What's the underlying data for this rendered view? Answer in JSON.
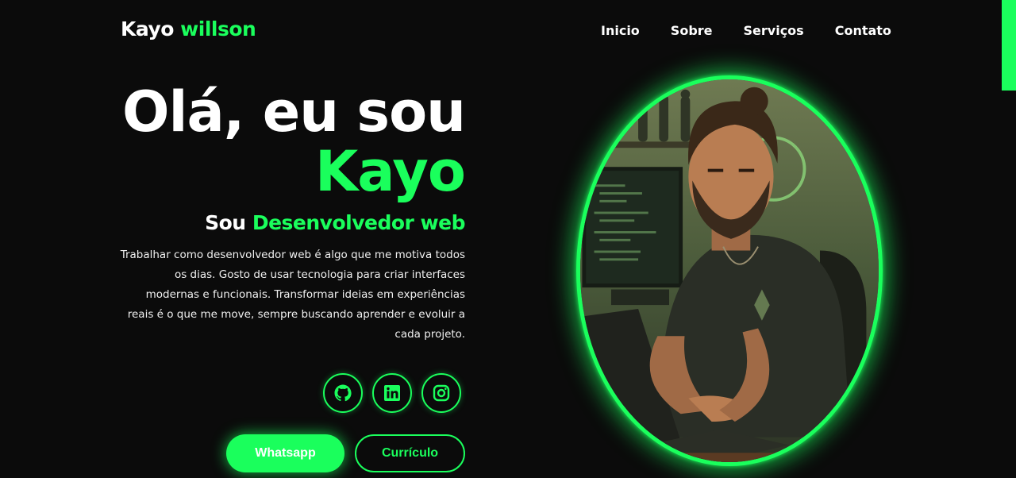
{
  "header": {
    "logo_first": "Kayo",
    "logo_second": "willson",
    "nav": [
      "Inicio",
      "Sobre",
      "Serviços",
      "Contato"
    ]
  },
  "hero": {
    "greeting": "Olá, eu sou",
    "name": "Kayo",
    "subtitle_prefix": "Sou",
    "subtitle_role": "Desenvolvedor web",
    "description": "Trabalhar como desenvolvedor web é algo que me motiva todos os dias. Gosto de usar tecnologia para criar interfaces modernas e funcionais. Transformar ideias em experiências reais é o que me move, sempre buscando aprender e evoluir a cada projeto."
  },
  "socials": [
    {
      "icon": "github-icon"
    },
    {
      "icon": "linkedin-icon"
    },
    {
      "icon": "instagram-icon"
    }
  ],
  "buttons": {
    "whatsapp": "Whatsapp",
    "curriculo": "Currículo"
  },
  "colors": {
    "accent": "#1aff5c",
    "background": "#0b0b0b",
    "text": "#ffffff"
  }
}
